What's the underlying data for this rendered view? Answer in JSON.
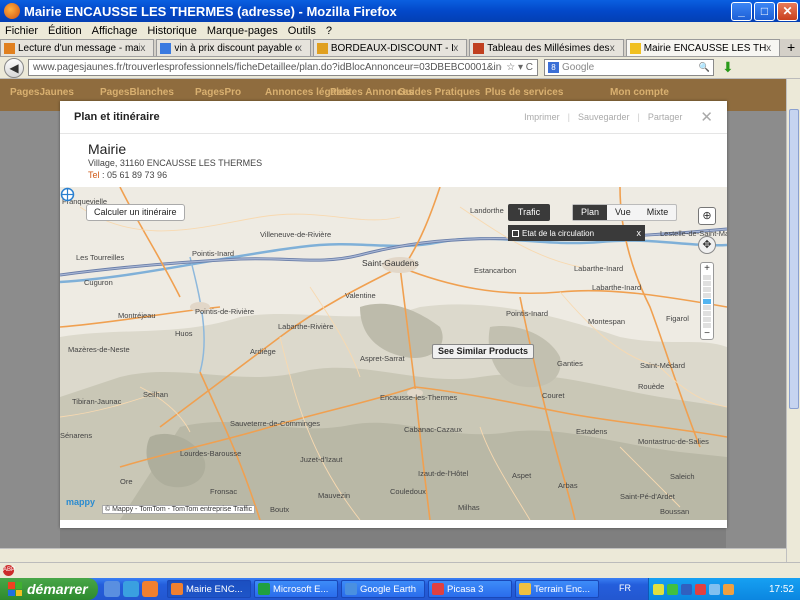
{
  "window": {
    "title": "Mairie ENCAUSSE LES THERMES (adresse) - Mozilla Firefox",
    "min_label": "_",
    "max_label": "□",
    "close_label": "✕"
  },
  "menu": [
    "Fichier",
    "Édition",
    "Affichage",
    "Historique",
    "Marque-pages",
    "Outils",
    "?"
  ],
  "tabs": [
    {
      "label": "Lecture d'un message - mail ...",
      "color": "#e08020"
    },
    {
      "label": "vin à prix discount payable en...",
      "color": "#3a7ae0"
    },
    {
      "label": "BORDEAUX-DISCOUNT - Pro...",
      "color": "#e0a020"
    },
    {
      "label": "Tableau des Millésimes des vi...",
      "color": "#c04020"
    },
    {
      "label": "Mairie ENCAUSSE LES THER...",
      "color": "#f0c020"
    }
  ],
  "tab_close": "x",
  "newtab_label": "+",
  "nav": {
    "back_label": "◀",
    "url": "www.pagesjaunes.fr/trouverlesprofessionnels/ficheDetaillee/plan.do?idBlocAnnonceur=03DBEBC0001&indexInscription",
    "url_icons": "☆ ▾ C",
    "search_placeholder": "Google",
    "search_engine_glyph": "8",
    "search_go": "🔍",
    "download_glyph": "⬇"
  },
  "pj_header": {
    "items": [
      "PagesJaunes",
      "PagesBlanches",
      "PagesPro",
      "Annonces légales",
      "Petites Annonces",
      "Guides Pratiques",
      "Plus de services",
      "Mon compte"
    ]
  },
  "modal": {
    "title": "Plan et itinéraire",
    "actions": [
      "Imprimer",
      "Sauvegarder",
      "Partager"
    ],
    "separator": "|",
    "close": "✕",
    "name": "Mairie",
    "address": "Village, 31160 ENCAUSSE LES THERMES",
    "tel_label": "Tel",
    "tel": " : 05 61 89 73 96"
  },
  "map": {
    "calc_button": "Calculer un itinéraire",
    "trafic": "Trafic",
    "modes": [
      "Plan",
      "Vue",
      "Mixte"
    ],
    "active_mode": "Plan",
    "etat_label": "Etat de la circulation",
    "etat_close": "x",
    "nav_glyph": "⊕",
    "pan_glyph": "✥",
    "zoom_plus": "+",
    "zoom_minus": "−",
    "zoom_level_fraction": 0.44,
    "similar_button": "See Similar Products",
    "logo": "mappy",
    "copyright": "© Mappy - TomTom - TomTom entreprise Traffic",
    "towns": [
      {
        "name": "Franquevielle"
      },
      {
        "name": "Landorthe"
      },
      {
        "name": "Villeneuve-de-Rivière"
      },
      {
        "name": "Les Tourreilles"
      },
      {
        "name": "Pointis-Inard"
      },
      {
        "name": "Saint-Gaudens"
      },
      {
        "name": "Estancarbon"
      },
      {
        "name": "Labarthe-Inard"
      },
      {
        "name": "Lestelle-de-Saint-Martory"
      },
      {
        "name": "Cuguron"
      },
      {
        "name": "Valentine"
      },
      {
        "name": "Labarthe-Inard"
      },
      {
        "name": "Montréjeau"
      },
      {
        "name": "Pointis-de-Rivière"
      },
      {
        "name": "Labarthe-Rivière"
      },
      {
        "name": "Pointis-Inard"
      },
      {
        "name": "Montespan"
      },
      {
        "name": "Figarol"
      },
      {
        "name": "Mazères-de-Neste"
      },
      {
        "name": "Huos"
      },
      {
        "name": "Ardiège"
      },
      {
        "name": "Aspret-Sarrat"
      },
      {
        "name": "Ganties"
      },
      {
        "name": "Saint-Médard"
      },
      {
        "name": "Tibiran-Jaunac"
      },
      {
        "name": "Seilhan"
      },
      {
        "name": "Encausse-les-Thermes"
      },
      {
        "name": "Couret"
      },
      {
        "name": "Rouède"
      },
      {
        "name": "Sauveterre-de-Comminges"
      },
      {
        "name": "Cabanac-Cazaux"
      },
      {
        "name": "Estadens"
      },
      {
        "name": "Montastruc-de-Salies"
      },
      {
        "name": "Sénarens"
      },
      {
        "name": "Lourdes-Barousse"
      },
      {
        "name": "Juzet-d'Izaut"
      },
      {
        "name": "Izaut-de-l'Hôtel"
      },
      {
        "name": "Aspet"
      },
      {
        "name": "Arbas"
      },
      {
        "name": "Mauvezin"
      },
      {
        "name": "Milhas"
      },
      {
        "name": "Ore"
      },
      {
        "name": "Boutx"
      },
      {
        "name": "Fronsac"
      },
      {
        "name": "Couledoux"
      },
      {
        "name": "Saint-Pé-d'Ardet"
      },
      {
        "name": "Saleich"
      },
      {
        "name": "Boussan"
      }
    ]
  },
  "taskbar": {
    "start": "démarrer",
    "tasks": [
      {
        "label": "Mairie ENC...",
        "color": "#f08030",
        "active": true
      },
      {
        "label": "Microsoft E...",
        "color": "#20a040",
        "active": false
      },
      {
        "label": "Google Earth",
        "color": "#4a90e0",
        "active": false
      },
      {
        "label": "Picasa 3",
        "color": "#e04040",
        "active": false
      },
      {
        "label": "Terrain Enc...",
        "color": "#f0c040",
        "active": false
      }
    ],
    "lang": "FR",
    "clock": "17:52"
  },
  "status": {
    "abp": "ABP"
  }
}
